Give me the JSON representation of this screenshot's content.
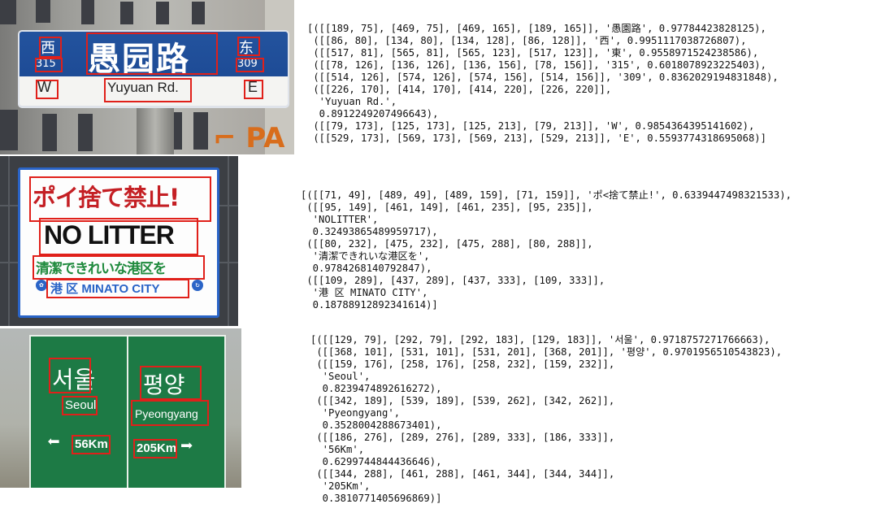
{
  "examples": [
    {
      "sign": {
        "line1": "愚园路",
        "west_cn": "西",
        "west_num": "315",
        "east_cn": "东",
        "east_num": "309",
        "english": "Yuyuan Rd.",
        "west": "W",
        "east": "E"
      },
      "output_lines": [
        "[([[189, 75], [469, 75], [469, 165], [189, 165]], '愚園路', 0.97784423828125),",
        " ([[86, 80], [134, 80], [134, 128], [86, 128]], '西', 0.9951117038726807),",
        " ([[517, 81], [565, 81], [565, 123], [517, 123]], '東', 0.9558971524238586),",
        " ([[78, 126], [136, 126], [136, 156], [78, 156]], '315', 0.6018078923225403),",
        " ([[514, 126], [574, 126], [574, 156], [514, 156]], '309', 0.8362029194831848),",
        " ([[226, 170], [414, 170], [414, 220], [226, 220]],",
        "  'Yuyuan Rd.',",
        "  0.8912249207496643),",
        " ([[79, 173], [125, 173], [125, 213], [79, 213]], 'W', 0.9854364395141602),",
        " ([[529, 173], [569, 173], [569, 213], [529, 213]], 'E', 0.5593774318695068)]"
      ]
    },
    {
      "sign": {
        "japanese_title": "ポイ捨て禁止!",
        "english": "NO LITTER",
        "japanese_sub": "清潔できれいな港区を",
        "footer": "港 区  MINATO CITY"
      },
      "output_lines": [
        "[([[71, 49], [489, 49], [489, 159], [71, 159]], 'ポ<捨て禁止!', 0.6339447498321533),",
        " ([[95, 149], [461, 149], [461, 235], [95, 235]],",
        "  'NOLITTER',",
        "  0.32493865489959717),",
        " ([[80, 232], [475, 232], [475, 288], [80, 288]],",
        "  '清潔できれいな港区を',",
        "  0.9784268140792847),",
        " ([[109, 289], [437, 289], [437, 333], [109, 333]],",
        "  '港 区 MINATO CITY',",
        "  0.18788912892341614)]"
      ]
    },
    {
      "sign": {
        "left_kr": "서울",
        "left_en": "Seoul",
        "left_km": "56Km",
        "right_kr": "평양",
        "right_en": "Pyeongyang",
        "right_km": "205Km"
      },
      "output_lines": [
        "[([[129, 79], [292, 79], [292, 183], [129, 183]], '서울', 0.9718757271766663),",
        " ([[368, 101], [531, 101], [531, 201], [368, 201]], '평양', 0.9701956510543823),",
        " ([[159, 176], [258, 176], [258, 232], [159, 232]],",
        "  'Seoul',",
        "  0.8239474892616272),",
        " ([[342, 189], [539, 189], [539, 262], [342, 262]],",
        "  'Pyeongyang',",
        "  0.3528004288673401),",
        " ([[186, 276], [289, 276], [289, 333], [186, 333]],",
        "  '56Km',",
        "  0.6299744844436646),",
        " ([[344, 288], [461, 288], [461, 344], [344, 344]],",
        "  '205Km',",
        "  0.3810771405696869)]"
      ]
    }
  ]
}
